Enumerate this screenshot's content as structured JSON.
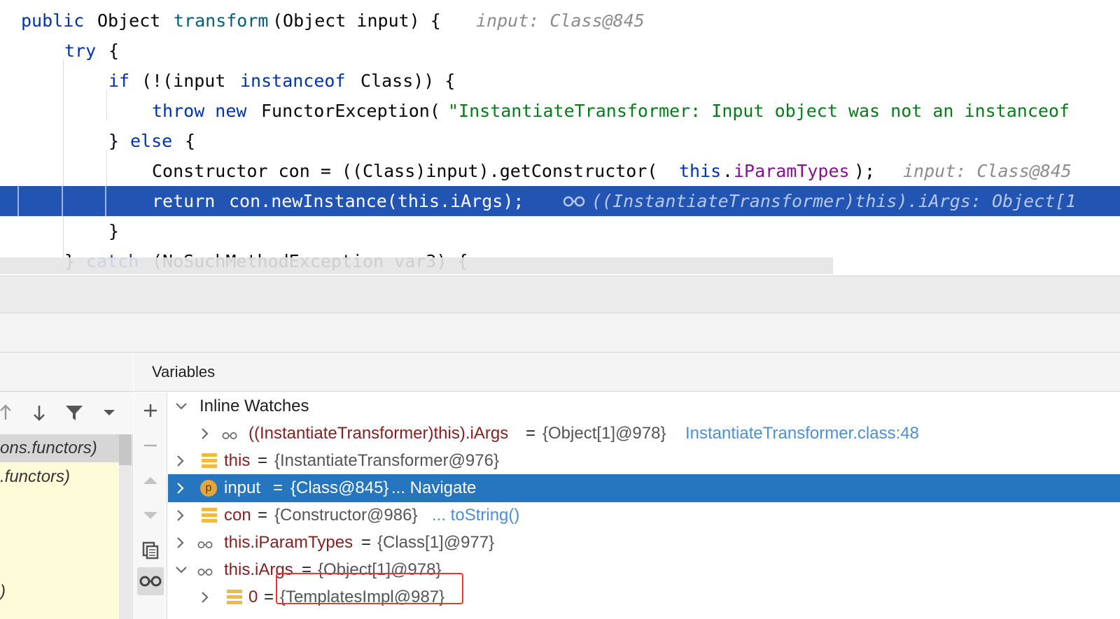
{
  "editor": {
    "lines": [
      {
        "parts": [
          [
            "kw",
            "public"
          ],
          [
            "",
            "Object"
          ],
          [
            "fn",
            "transform"
          ],
          [
            "",
            "(Object input) {"
          ]
        ],
        "hint": "input: Class@845"
      },
      {
        "parts": [
          [
            "kw",
            "try"
          ],
          [
            "",
            "{"
          ]
        ]
      },
      {
        "parts": [
          [
            "kw",
            "if"
          ],
          [
            "",
            "(!(input"
          ],
          [
            "kw",
            "instanceof"
          ],
          [
            "",
            "Class)) {"
          ]
        ]
      },
      {
        "parts": [
          [
            "kw",
            "throw new"
          ],
          [
            "",
            "FunctorException("
          ],
          [
            "str",
            "\"InstantiateTransformer: Input object was not an instanceof"
          ]
        ]
      },
      {
        "parts": [
          [
            "",
            "}"
          ],
          [
            "kw",
            "else"
          ],
          [
            "",
            "{"
          ]
        ]
      },
      {
        "parts": [
          [
            "",
            "Constructor con = ((Class)input).getConstructor("
          ],
          [
            "kw",
            "this"
          ],
          [
            "",
            "."
          ],
          [
            "fld",
            "iParamTypes"
          ],
          [
            "",
            ");"
          ]
        ],
        "hint": "input: Class@845"
      },
      {
        "parts": [
          [
            "kw",
            "return"
          ],
          [
            "",
            "con.newInstance(this.iArgs);"
          ]
        ],
        "hint": "((InstantiateTransformer)this).iArgs: Object[1"
      },
      {
        "parts": [
          [
            "",
            "}"
          ]
        ]
      },
      {
        "parts": [
          [
            "",
            "}"
          ],
          [
            "kw",
            "catch"
          ],
          [
            "",
            "(NoSuchMethodException var3) {"
          ]
        ]
      }
    ]
  },
  "frames": {
    "items": [
      "ons.functors)",
      ".functors)",
      ")"
    ]
  },
  "variables": {
    "title": "Variables",
    "rows": {
      "inline_watches": {
        "label": "Inline Watches"
      },
      "watch_iargs": {
        "name": "((InstantiateTransformer)this).iArgs",
        "eq": "=",
        "value": "{Object[1]@978}",
        "link": "InstantiateTransformer.class:48"
      },
      "this": {
        "name": "this",
        "eq": "=",
        "value": "{InstantiateTransformer@976}"
      },
      "input": {
        "badge": "p",
        "name": "input",
        "eq": "=",
        "value": "{Class@845}",
        "link": "... Navigate"
      },
      "con": {
        "name": "con",
        "eq": "=",
        "value": "{Constructor@986}",
        "link": "... toString()"
      },
      "iparamtypes": {
        "name": "this.iParamTypes",
        "eq": "=",
        "value": "{Class[1]@977}"
      },
      "iargs": {
        "name": "this.iArgs",
        "eq": "=",
        "value": "{Object[1]@978}"
      },
      "iargs0": {
        "name": "0",
        "eq": "=",
        "value": "{TemplatesImpl@987}"
      }
    }
  },
  "colors": {
    "exec_line": "#2154b3",
    "selected_row": "#2675bf",
    "highlight_box": "#e53935",
    "keyword": "#0033b3",
    "string": "#067d17",
    "field": "#871094"
  },
  "icons": [
    "glasses-icon",
    "field-icon",
    "param-icon",
    "plus-icon",
    "minus-icon",
    "up-icon",
    "down-icon",
    "copy-icon",
    "arrow-up-icon",
    "arrow-down-icon",
    "filter-icon",
    "dropdown-icon",
    "chevron-right-icon",
    "chevron-down-icon"
  ]
}
